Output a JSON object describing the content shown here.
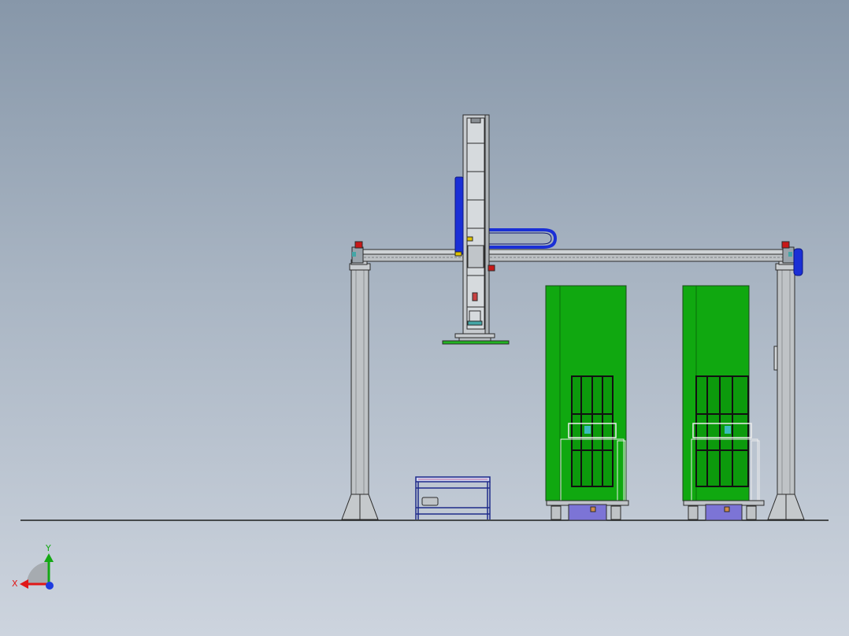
{
  "view": {
    "background_top": "#8797a9",
    "background_bottom": "#cdd4de"
  },
  "model": {
    "components": [
      "gantry-frame",
      "vertical-axis-column",
      "cable-chain",
      "workpiece-cart",
      "machine-cabinet-left",
      "machine-cabinet-right"
    ],
    "colors": {
      "frame": "#bfc3c6",
      "frame_edge": "#2b2b2b",
      "cabinet_green": "#10a810",
      "drive_blue": "#1a2fd6",
      "base_purple": "#7c74d6",
      "accent_red": "#c81818"
    }
  },
  "triad": {
    "x_label": "X",
    "y_label": "Y",
    "x_color": "#e01818",
    "y_color": "#14a814",
    "z_color": "#1e3ce0"
  }
}
